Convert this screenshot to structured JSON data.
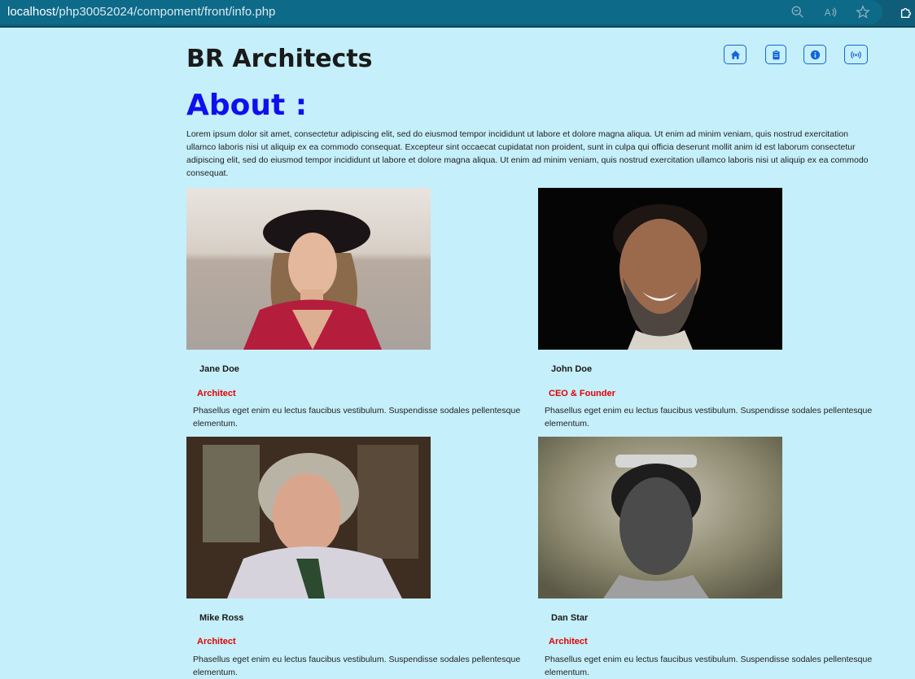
{
  "browser": {
    "url_host": "localhost",
    "url_path": "/php30052024/compoment/front/info.php",
    "icons": [
      "zoom-out-icon",
      "read-aloud-icon",
      "favorite-star-icon",
      "extensions-icon"
    ]
  },
  "header": {
    "brand": "BR Architects",
    "nav": [
      {
        "icon": "home-icon"
      },
      {
        "icon": "clipboard-icon"
      },
      {
        "icon": "info-icon"
      },
      {
        "icon": "broadcast-icon"
      }
    ]
  },
  "about": {
    "title": "About :",
    "text": "Lorem ipsum dolor sit amet, consectetur adipiscing elit, sed do eiusmod tempor incididunt ut labore et dolore magna aliqua. Ut enim ad minim veniam, quis nostrud exercitation ullamco laboris nisi ut aliquip ex ea commodo consequat. Excepteur sint occaecat cupidatat non proident, sunt in culpa qui officia deserunt mollit anim id est laborum consectetur adipiscing elit, sed do eiusmod tempor incididunt ut labore et dolore magna aliqua. Ut enim ad minim veniam, quis nostrud exercitation ullamco laboris nisi ut aliquip ex ea commodo consequat."
  },
  "team": [
    {
      "name": "Jane Doe",
      "role": "Architect",
      "desc": "Phasellus eget enim eu lectus faucibus vestibulum. Suspendisse sodales pellentesque elementum."
    },
    {
      "name": "John Doe",
      "role": "CEO & Founder",
      "desc": "Phasellus eget enim eu lectus faucibus vestibulum. Suspendisse sodales pellentesque elementum."
    },
    {
      "name": "Mike Ross",
      "role": "Architect",
      "desc": "Phasellus eget enim eu lectus faucibus vestibulum. Suspendisse sodales pellentesque elementum."
    },
    {
      "name": "Dan Star",
      "role": "Architect",
      "desc": "Phasellus eget enim eu lectus faucibus vestibulum. Suspendisse sodales pellentesque elementum."
    }
  ],
  "colors": {
    "background": "#c5effa",
    "about_title": "#1010ee",
    "role": "#e30000",
    "nav_border": "#1565d8"
  }
}
